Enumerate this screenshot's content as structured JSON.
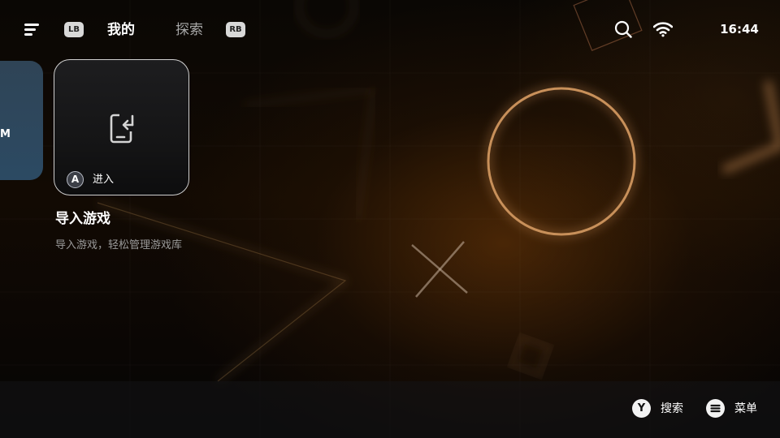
{
  "header": {
    "menu_icon": "hamburger-menu-icon",
    "lb_label": "LB",
    "rb_label": "RB",
    "tabs": [
      {
        "label": "我的",
        "active": true
      },
      {
        "label": "探索",
        "active": false
      }
    ],
    "search_icon": "search-icon",
    "wifi_icon": "wifi-icon",
    "time": "16:44"
  },
  "peek_card": {
    "partial_text": "M"
  },
  "feature_card": {
    "icon": "import-phone-arrow-icon",
    "button_glyph": "A",
    "button_label": "进入",
    "title": "导入游戏",
    "subtitle": "导入游戏，轻松管理游戏库"
  },
  "footer_hints": [
    {
      "glyph": "Y",
      "label": "搜索"
    },
    {
      "glyph": "menu-lines-icon",
      "label": "菜单"
    }
  ],
  "colors": {
    "accent_glow": "#c8905a",
    "background": "#0a0704",
    "card_border": "#cfcfcf"
  }
}
